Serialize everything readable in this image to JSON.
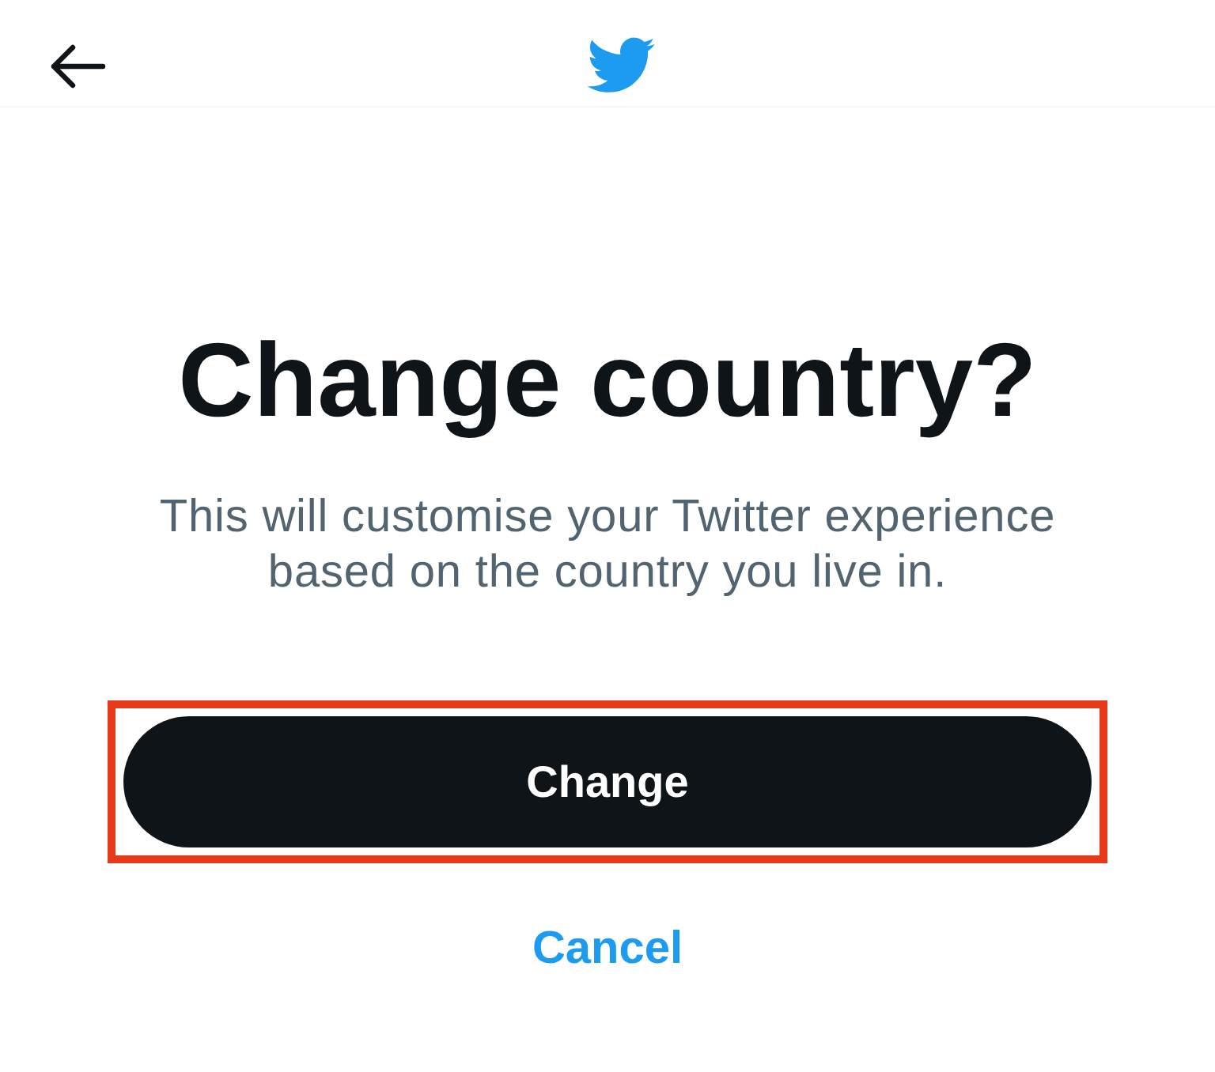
{
  "title": "Change country?",
  "description": "This will customise your Twitter experience based on the country you live in.",
  "primary_button": {
    "label": "Change",
    "highlighted": true
  },
  "cancel_link": {
    "label": "Cancel"
  }
}
